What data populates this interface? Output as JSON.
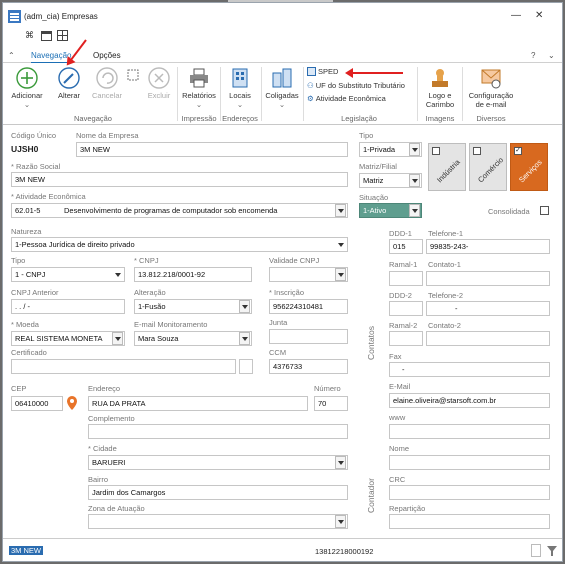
{
  "window": {
    "title": "(adm_cia)  Empresas"
  },
  "ribbon_tabs": [
    "Navegação",
    "Opções"
  ],
  "ribbon_right": {
    "help": "?",
    "expand": "⌄"
  },
  "ribbon": {
    "adicionar": "Adicionar",
    "alterar": "Alterar",
    "cancelar": "Cancelar",
    "excluir": "Excluir",
    "relatorios": "Relatórios",
    "locais": "Locais",
    "coligadas": "Coligadas",
    "sped": "SPED",
    "uf_sub": "UF do Substituto Tributário",
    "atividade": "Atividade Econômica",
    "logo_line1": "Logo e",
    "logo_line2": "Carimbo",
    "config_line1": "Configuração",
    "config_line2": "de e-mail",
    "groups": {
      "navegacao": "Navegação",
      "impressao": "Impressão",
      "enderecos": "Endereços",
      "legislacao": "Legislação",
      "imagens": "Imagens",
      "diversos": "Diversos"
    }
  },
  "form": {
    "codigo_unico_label": "Código Único",
    "codigo_unico": "UJSH0",
    "nome_empresa_label": "Nome da Empresa",
    "nome_empresa": "3M NEW",
    "razao_social_label": "* Razão Social",
    "razao_social": "3M NEW",
    "atividade_label": "* Atividade Econômica",
    "atividade_codigo": "62.01-5",
    "atividade_desc": "Desenvolvimento de programas de computador sob encomenda",
    "natureza_label": "Natureza",
    "natureza": "1-Pessoa Jurídica de direito privado",
    "tipo_doc_label": "Tipo",
    "tipo_doc": "1 - CNPJ",
    "cnpj_label": "* CNPJ",
    "cnpj": "13.812.218/0001-92",
    "validade_cnpj_label": "Validade CNPJ",
    "cnpj_anterior_label": "CNPJ Anterior",
    "cnpj_anterior": " .  .  /    -",
    "alteracao_label": "Alteração",
    "alteracao": "1-Fusão",
    "inscricao_label": "* Inscrição",
    "inscricao": "956224310481",
    "moeda_label": "* Moeda",
    "moeda": "REAL    SISTEMA MONETA",
    "email_monit_label": "E-mail Monitoramento",
    "email_monit": "Mara Souza",
    "junta_label": "Junta",
    "certificado_label": "Certificado",
    "ccm_label": "CCM",
    "ccm": "4376733",
    "tipo_label": "Tipo",
    "tipo": "1-Privada",
    "matriz_label": "Matriz/Filial",
    "matriz": "Matriz",
    "situacao_label": "Situação",
    "situacao": "1-Ativo",
    "consolidada_label": "Consolidada",
    "tiles": [
      "Indústria",
      "Comércio",
      "Serviços"
    ],
    "cep_label": "CEP",
    "cep": "06410000",
    "endereco_label": "Endereço",
    "endereco": "RUA DA PRATA",
    "numero_label": "Número",
    "numero": "70",
    "complemento_label": "Complemento",
    "cidade_label": "* Cidade",
    "cidade": "BARUERI",
    "bairro_label": "Bairro",
    "bairro": "Jardim dos Camargos",
    "zona_label": "Zona de Atuação"
  },
  "contatos": {
    "section_label": "Contatos",
    "ddd1_label": "DDD-1",
    "ddd1": "015",
    "tel1_label": "Telefone-1",
    "tel1": "99835-243-",
    "ramal1_label": "Ramal-1",
    "contato1_label": "Contato-1",
    "ddd2_label": "DDD-2",
    "tel2_label": "Telefone-2",
    "tel2": "-",
    "ramal2_label": "Ramal-2",
    "contato2_label": "Contato-2",
    "fax_label": "Fax",
    "fax": "-",
    "email_label": "E-Mail",
    "email": "elaine.oliveira@starsoft.com.br",
    "www_label": "www"
  },
  "contador": {
    "section_label": "Contador",
    "nome_label": "Nome",
    "crc_label": "CRC",
    "reparticao_label": "Repartição"
  },
  "statusbar": {
    "name": "3M NEW",
    "cnpj": "13812218000192"
  },
  "colors": {
    "accent": "#1b6fb5",
    "services_tile": "#d8691f",
    "situacao_bg": "#5f9e8f",
    "arrow": "#e02020"
  }
}
